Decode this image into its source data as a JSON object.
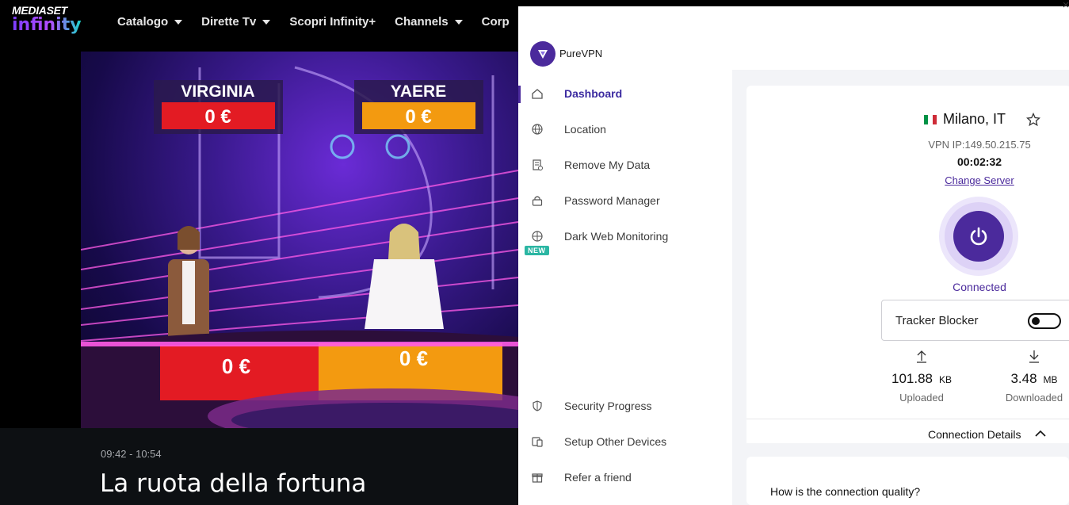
{
  "mediaset": {
    "brand_top": "MEDIASET",
    "brand_bottom": "infinity",
    "nav": [
      {
        "label": "Catalogo",
        "caret": true
      },
      {
        "label": "Dirette Tv",
        "caret": true
      },
      {
        "label": "Scopri Infinity+",
        "caret": false
      },
      {
        "label": "Channels",
        "caret": true
      },
      {
        "label": "Corp",
        "caret": false
      }
    ],
    "video": {
      "contestant_1": {
        "name": "VIRGINIA",
        "score": "0 €",
        "color": "#e31b23"
      },
      "contestant_2": {
        "name": "YAERE",
        "score": "0 €",
        "color": "#f39a10"
      },
      "podium_1": "0 €",
      "podium_2": "0 €"
    },
    "time_range": "09:42 - 10:54",
    "program_title": "La ruota della fortuna"
  },
  "vpn": {
    "app_name": "PureVPN",
    "accent": "#4b2a9c",
    "sidebar": {
      "items": [
        {
          "label": "Dashboard",
          "icon": "home-icon",
          "active": true
        },
        {
          "label": "Location",
          "icon": "globe-icon",
          "active": false
        },
        {
          "label": "Remove My Data",
          "icon": "document-icon",
          "active": false
        },
        {
          "label": "Password Manager",
          "icon": "lock-icon",
          "active": false
        },
        {
          "label": "Dark Web Monitoring",
          "icon": "shield-globe-icon",
          "active": false
        }
      ],
      "new_badge": "NEW",
      "bottom_items": [
        {
          "label": "Security Progress",
          "icon": "shield-icon"
        },
        {
          "label": "Setup Other Devices",
          "icon": "devices-icon"
        },
        {
          "label": "Refer a friend",
          "icon": "gift-icon"
        }
      ]
    },
    "location": {
      "name": "Milano, IT",
      "flag": [
        "#009246",
        "#ffffff",
        "#ce2b37"
      ]
    },
    "ip": "VPN IP:149.50.215.75",
    "timer": "00:02:32",
    "change_server": "Change Server",
    "status": "Connected",
    "tracker_blocker": {
      "label": "Tracker Blocker",
      "enabled": false
    },
    "upload": {
      "value": "101.88",
      "unit": "KB",
      "label": "Uploaded"
    },
    "download": {
      "value": "3.48",
      "unit": "MB",
      "label": "Downloaded"
    },
    "connection_details": "Connection Details",
    "quality_question": "How is the connection quality?"
  }
}
